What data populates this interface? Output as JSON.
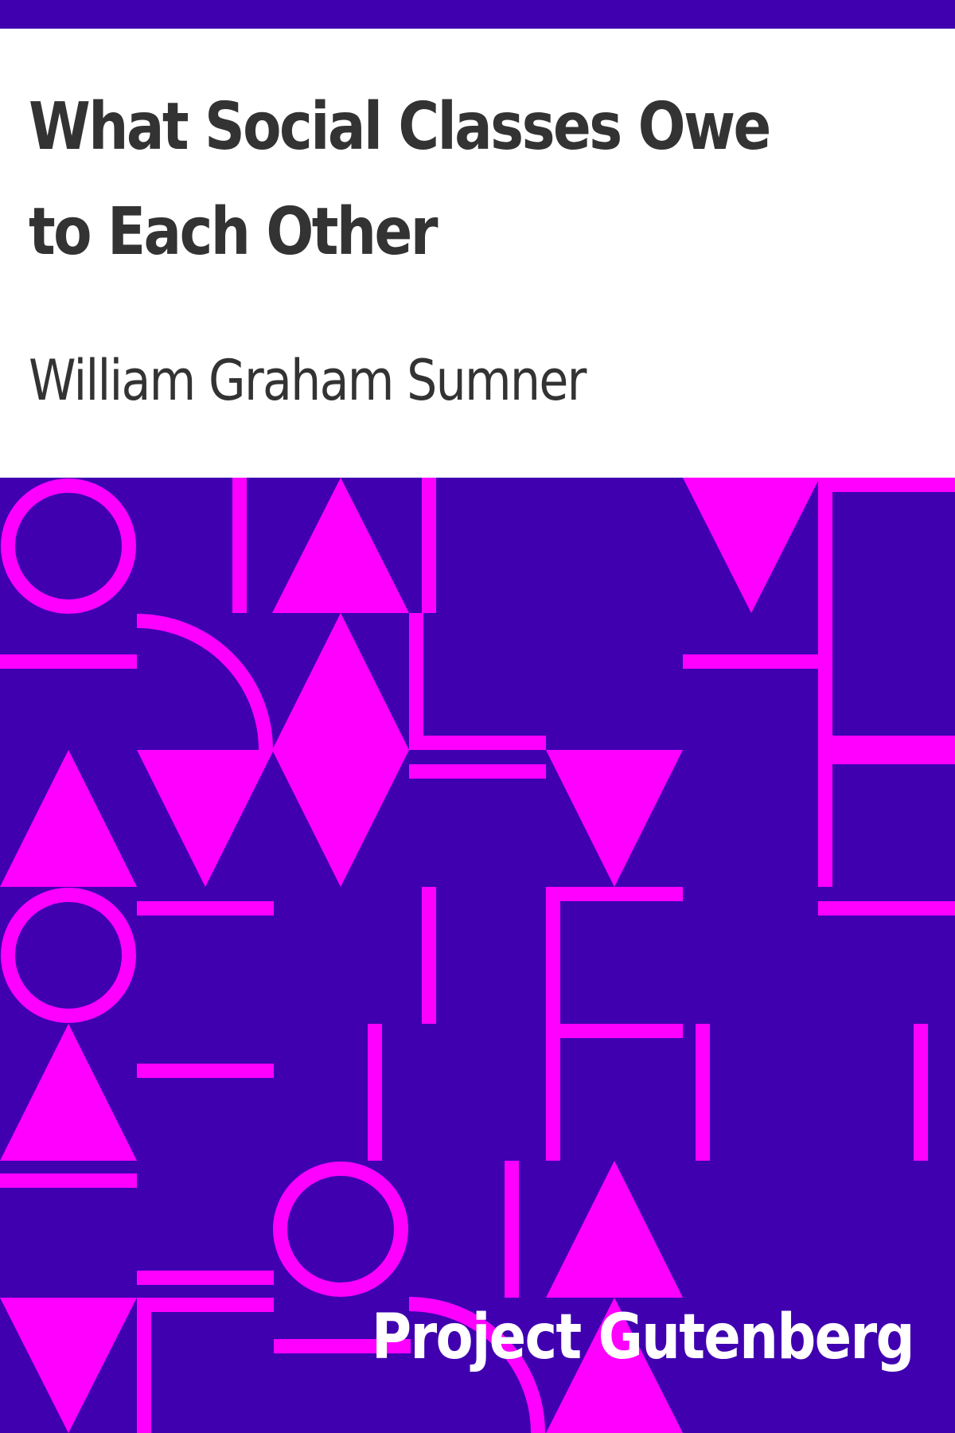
{
  "book": {
    "title": "What Social Classes Owe to Each Other",
    "author": "William Graham Sumner",
    "publisher": "Project Gutenberg"
  },
  "colors": {
    "background": "#4000b0",
    "pattern": "#ff00ff",
    "title_text": "#333333",
    "publisher_text": "#ffffff"
  }
}
